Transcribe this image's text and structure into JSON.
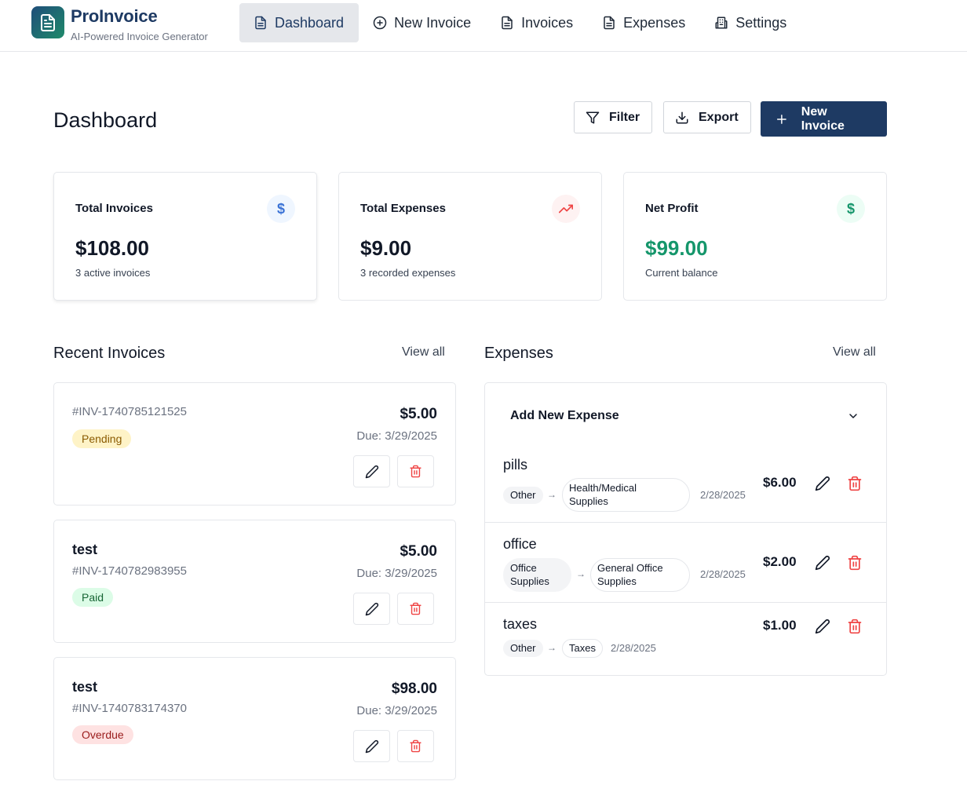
{
  "brand": {
    "title": "ProInvoice",
    "subtitle": "AI-Powered Invoice Generator",
    "icon": "document-icon"
  },
  "nav": [
    {
      "label": "Dashboard",
      "icon": "document-icon",
      "active": true
    },
    {
      "label": "New Invoice",
      "icon": "plus-circle-icon",
      "active": false
    },
    {
      "label": "Invoices",
      "icon": "document-icon",
      "active": false
    },
    {
      "label": "Expenses",
      "icon": "document-icon",
      "active": false
    },
    {
      "label": "Settings",
      "icon": "building-icon",
      "active": false
    }
  ],
  "page": {
    "title": "Dashboard",
    "filter_label": "Filter",
    "export_label": "Export",
    "new_invoice_label": "New Invoice"
  },
  "stats": [
    {
      "label": "Total Invoices",
      "value": "$108.00",
      "sub": "3 active invoices",
      "icon": "dollar-icon"
    },
    {
      "label": "Total Expenses",
      "value": "$9.00",
      "sub": "3 recorded expenses",
      "icon": "trending-up-icon"
    },
    {
      "label": "Net Profit",
      "value": "$99.00",
      "sub": "Current balance",
      "icon": "dollar-icon"
    }
  ],
  "recent_invoices": {
    "title": "Recent Invoices",
    "view_all": "View all",
    "items": [
      {
        "name": "",
        "number": "#INV-1740785121525",
        "status": "Pending",
        "amount": "$5.00",
        "due": "Due: 3/29/2025"
      },
      {
        "name": "test",
        "number": "#INV-1740782983955",
        "status": "Paid",
        "amount": "$5.00",
        "due": "Due: 3/29/2025"
      },
      {
        "name": "test",
        "number": "#INV-1740783174370",
        "status": "Overdue",
        "amount": "$98.00",
        "due": "Due: 3/29/2025"
      }
    ]
  },
  "expenses": {
    "title": "Expenses",
    "view_all": "View all",
    "add_label": "Add New Expense",
    "arrow": "→",
    "items": [
      {
        "name": "pills",
        "category": "Other",
        "subcategory_l1": "Health/Medical",
        "subcategory_l2": "Supplies",
        "date": "2/28/2025",
        "amount": "$6.00"
      },
      {
        "name": "office",
        "category_l1": "Office",
        "category_l2": "Supplies",
        "subcategory_l1": "General Office",
        "subcategory_l2": "Supplies",
        "date": "2/28/2025",
        "amount": "$2.00"
      },
      {
        "name": "taxes",
        "category": "Other",
        "subcategory": "Taxes",
        "date": "2/28/2025",
        "amount": "$1.00"
      }
    ]
  },
  "colors": {
    "primary": "#1e3a63",
    "profit_green": "#15966b",
    "delete_red": "#ef4444",
    "dollar_blue_bg": "#eff6ff",
    "trend_red_bg": "#fef2f2",
    "dollar_green_bg": "#ecfdf5"
  }
}
